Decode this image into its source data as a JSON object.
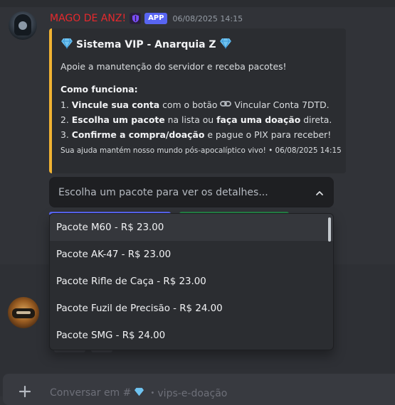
{
  "message": {
    "username": "MAGO DE ANZ!",
    "app_tag": "APP",
    "timestamp": "06/08/2025 14:15"
  },
  "embed": {
    "accent_color": "#f0b232",
    "title": "Sistema VIP - Anarquia Z",
    "title_icon": "gem-icon",
    "intro": "Apoie a manutenção do servidor e receba pacotes!",
    "how_heading": "Como funciona:",
    "step1": {
      "num": "1. ",
      "bold": "Vincule sua conta",
      "rest": " com o botão ",
      "link_icon": "link-icon",
      "tail": " Vincular Conta 7DTD."
    },
    "step2": {
      "num": "2. ",
      "bold1": "Escolha um pacote",
      "mid": " na lista ou ",
      "bold2": "faça uma doação",
      "tail": " direta."
    },
    "step3": {
      "num": "3. ",
      "bold": "Confirme a compra/doação",
      "tail": " e pague o PIX para receber!"
    },
    "footer": "Sua ajuda mantém nosso mundo pós-apocalíptico vivo! • 06/08/2025 14:15"
  },
  "select": {
    "placeholder": "Escolha um pacote para ver os detalhes...",
    "options": [
      "Pacote M60 - R$ 23.00",
      "Pacote AK-47 - R$ 23.00",
      "Pacote Rifle de Caça - R$ 23.00",
      "Pacote Fuzil de Precisão - R$ 24.00",
      "Pacote SMG - R$ 24.00"
    ]
  },
  "composer": {
    "placeholder_prefix": "Conversar em #",
    "channel": "・vips-e-doação"
  },
  "colors": {
    "username": "#e7292d",
    "app_tag": "#5865f2",
    "button_primary": "#5865f2",
    "button_success": "#248046"
  }
}
